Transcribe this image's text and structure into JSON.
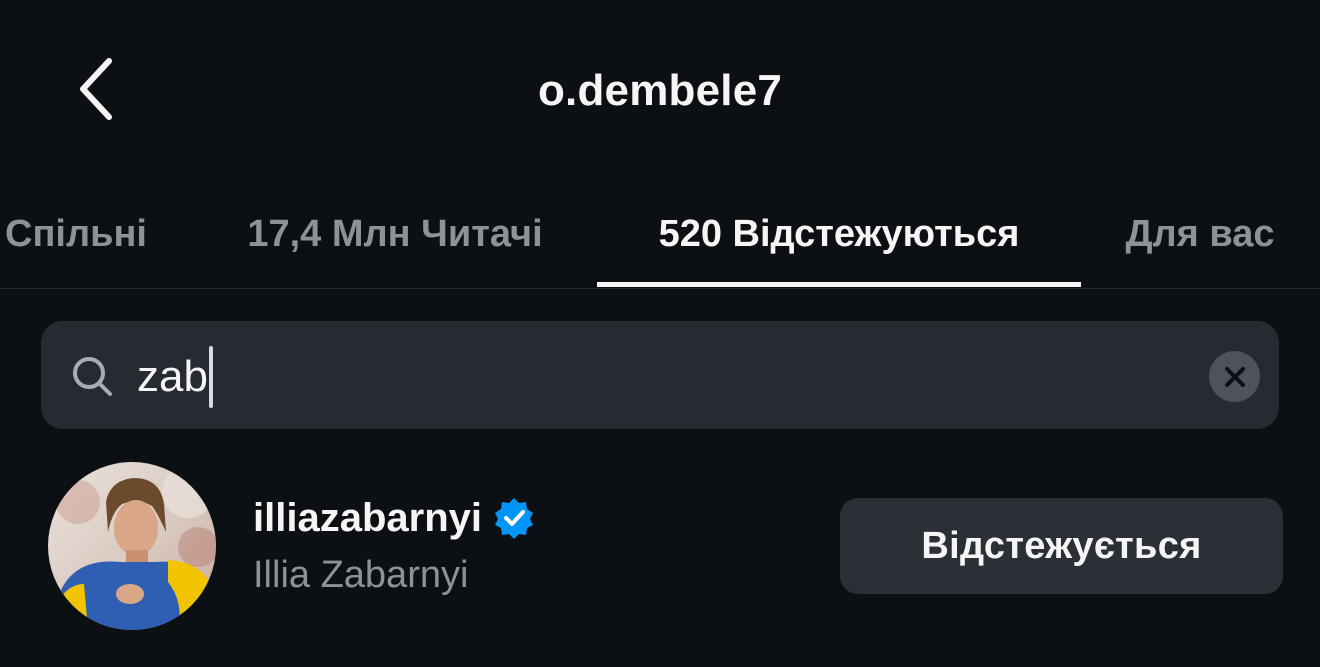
{
  "header": {
    "title": "o.dembele7",
    "back_icon": "chevron-left-icon"
  },
  "tabs": [
    {
      "label": "Спільні",
      "active": false
    },
    {
      "label": "17,4 Млн Читачі",
      "active": false
    },
    {
      "label": "520 Відстежуються",
      "active": true
    },
    {
      "label": "Для вас",
      "active": false
    }
  ],
  "search": {
    "value": "zab",
    "icon": "search-icon",
    "clear_icon": "close-icon"
  },
  "results": [
    {
      "username": "illiazabarnyi",
      "verified": true,
      "full_name": "Illia Zabarnyi",
      "button_label": "Відстежується"
    }
  ],
  "colors": {
    "background": "#0c1014",
    "search_background": "#262a31",
    "button_background": "#2b2f36",
    "primary_text": "#f5f5f5",
    "secondary_text": "#8e9196",
    "verified_blue": "#0095f6"
  }
}
